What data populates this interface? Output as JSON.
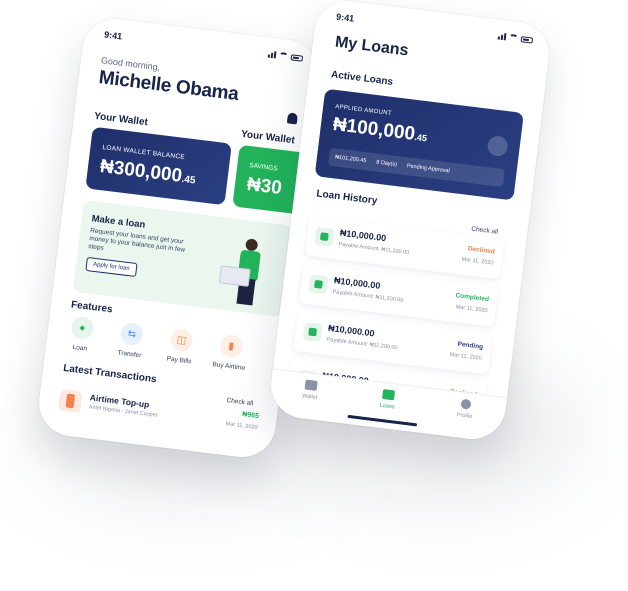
{
  "phone1": {
    "status_time": "9:41",
    "greeting": "Good morning,",
    "user_name": "Michelle Obama",
    "wallet_title": "Your Wallet",
    "wallet_title_2": "Your Wallet",
    "wallet_card": {
      "label": "LOAN WALLET BALANCE",
      "amount": "₦300,000",
      "cents": ".45"
    },
    "savings_card": {
      "label": "SAVINGS",
      "amount": "₦30"
    },
    "loan_promo": {
      "title": "Make a loan",
      "description": "Request your loans and get your money to your balance just in few steps",
      "button": "Apply for loan"
    },
    "features_title": "Features",
    "features": [
      {
        "label": "Loan",
        "icon": "loan-icon",
        "color": "#22b35b"
      },
      {
        "label": "Transfer",
        "icon": "transfer-icon",
        "color": "#3f8ff5"
      },
      {
        "label": "Pay Bills",
        "icon": "bills-icon",
        "color": "#f2834d"
      },
      {
        "label": "Buy Airtime",
        "icon": "airtime-icon",
        "color": "#f2834d"
      }
    ],
    "transactions_title": "Latest Transactions",
    "check_all": "Check all",
    "transaction": {
      "name": "Airtime Top-up",
      "sub": "Airtel Nigeria · Janet Cooper",
      "amount": "₦965",
      "date": "Mar 11, 2020"
    }
  },
  "phone2": {
    "status_time": "9:41",
    "title": "My Loans",
    "active_title": "Active Loans",
    "active_card": {
      "label": "APPLIED AMOUNT",
      "amount": "₦100,000",
      "cents": ".45",
      "payable": "₦101,200.45",
      "duration": "8 Day(s)",
      "status": "Pending Approval"
    },
    "history_title": "Loan History",
    "check_all": "Check all",
    "loans": [
      {
        "amount": "₦10,000.00",
        "payable": "Payable Amount: ₦11,200.00",
        "status": "Declined",
        "status_color": "#f2834d",
        "date": "Mar 11, 2020"
      },
      {
        "amount": "₦10,000.00",
        "payable": "Payable Amount: ₦11,200.00",
        "status": "Completed",
        "status_color": "#22b35b",
        "date": "Mar 11, 2020"
      },
      {
        "amount": "₦10,000.00",
        "payable": "Payable Amount: ₦11,200.00",
        "status": "Pending",
        "status_color": "#2a3f82",
        "date": "Mar 11, 2020"
      },
      {
        "amount": "₦10,000.00",
        "payable": "",
        "status": "Declined",
        "status_color": "#f2834d",
        "date": ""
      }
    ],
    "tabs": [
      {
        "label": "Wallet",
        "active": false
      },
      {
        "label": "Loans",
        "active": true
      },
      {
        "label": "Profile",
        "active": false
      }
    ]
  },
  "colors": {
    "navy": "#1f2f6a",
    "green": "#22b35b",
    "orange": "#f2834d"
  }
}
